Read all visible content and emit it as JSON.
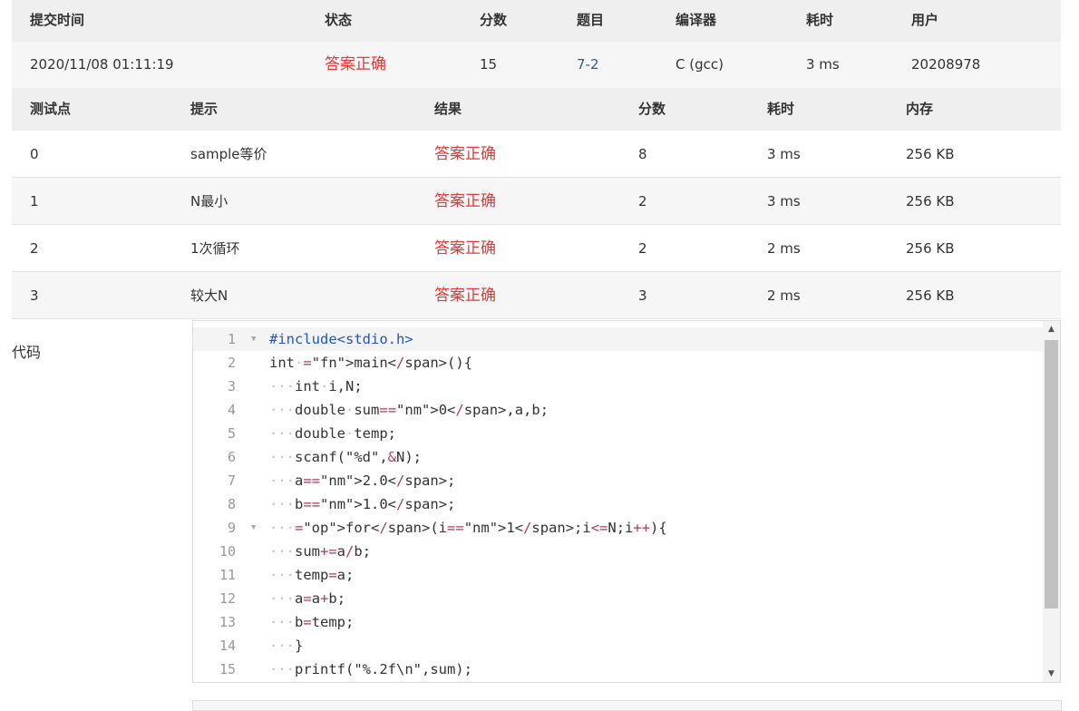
{
  "submission_header": [
    "提交时间",
    "状态",
    "分数",
    "题目",
    "编译器",
    "耗时",
    "用户"
  ],
  "submission": {
    "time": "2020/11/08 01:11:19",
    "status": "答案正确",
    "score": "15",
    "problem": "7-2",
    "compiler": "C (gcc)",
    "elapsed": "3 ms",
    "user": "20208978"
  },
  "tests_header": [
    "测试点",
    "提示",
    "结果",
    "分数",
    "耗时",
    "内存"
  ],
  "tests": [
    {
      "id": "0",
      "hint": "sample等价",
      "result": "答案正确",
      "score": "8",
      "time": "3 ms",
      "memory": "256 KB"
    },
    {
      "id": "1",
      "hint": "N最小",
      "result": "答案正确",
      "score": "2",
      "time": "3 ms",
      "memory": "256 KB"
    },
    {
      "id": "2",
      "hint": "1次循环",
      "result": "答案正确",
      "score": "2",
      "time": "2 ms",
      "memory": "256 KB"
    },
    {
      "id": "3",
      "hint": "较大N",
      "result": "答案正确",
      "score": "3",
      "time": "2 ms",
      "memory": "256 KB"
    }
  ],
  "code_label": "代码",
  "code_lines": [
    {
      "n": "1",
      "indent": "",
      "text": "#include<stdio.h>",
      "fold": true
    },
    {
      "n": "2",
      "indent": "",
      "text": "int·main(){",
      "fold": false
    },
    {
      "n": "3",
      "indent": "···",
      "text": "int·i,N;",
      "fold": false
    },
    {
      "n": "4",
      "indent": "···",
      "text": "double·sum=0,a,b;",
      "fold": false
    },
    {
      "n": "5",
      "indent": "···",
      "text": "double·temp;",
      "fold": false
    },
    {
      "n": "6",
      "indent": "···",
      "text": "scanf(\"%d\",&N);",
      "fold": false
    },
    {
      "n": "7",
      "indent": "···",
      "text": "a=2.0;",
      "fold": false
    },
    {
      "n": "8",
      "indent": "···",
      "text": "b=1.0;",
      "fold": false
    },
    {
      "n": "9",
      "indent": "···",
      "text": "for(i=1;i<=N;i++){",
      "fold": true
    },
    {
      "n": "10",
      "indent": "···",
      "text": "sum+=a/b;",
      "fold": false
    },
    {
      "n": "11",
      "indent": "···",
      "text": "temp=a;",
      "fold": false
    },
    {
      "n": "12",
      "indent": "···",
      "text": "a=a+b;",
      "fold": false
    },
    {
      "n": "13",
      "indent": "···",
      "text": "b=temp;",
      "fold": false
    },
    {
      "n": "14",
      "indent": "···",
      "text": "}",
      "fold": false
    },
    {
      "n": "15",
      "indent": "···",
      "text": "printf(\"%.2f\\n\",sum);",
      "fold": false
    }
  ],
  "colors": {
    "accepted": "#e53935",
    "link": "#2f5aa8"
  }
}
